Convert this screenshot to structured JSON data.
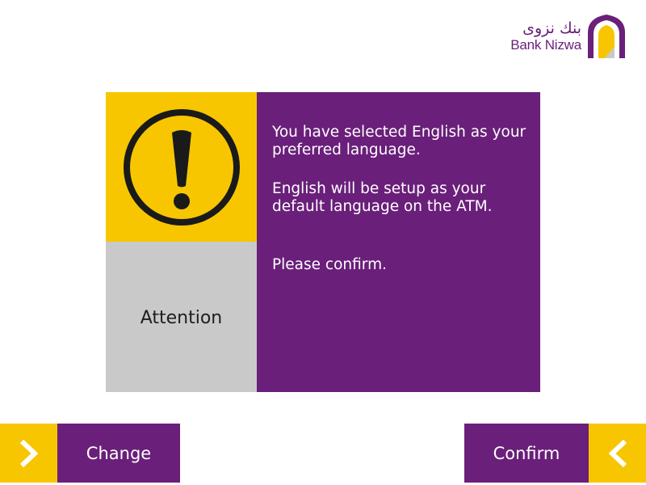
{
  "brand": {
    "name_ar": "بنك نزوى",
    "name_en": "Bank Nizwa",
    "colors": {
      "purple": "#6a1f7a",
      "yellow": "#f7c600",
      "gray": "#c9c9c9"
    }
  },
  "dialog": {
    "icon": "warning-exclamation-icon",
    "title": "Attention",
    "message_1": "You have selected English as your preferred language.",
    "message_2": "English will be setup as your default language on the ATM.",
    "message_3": "Please confirm."
  },
  "buttons": {
    "left": {
      "label": "Change",
      "icon": "chevron-right-icon"
    },
    "right": {
      "label": "Confirm",
      "icon": "chevron-left-icon"
    }
  }
}
